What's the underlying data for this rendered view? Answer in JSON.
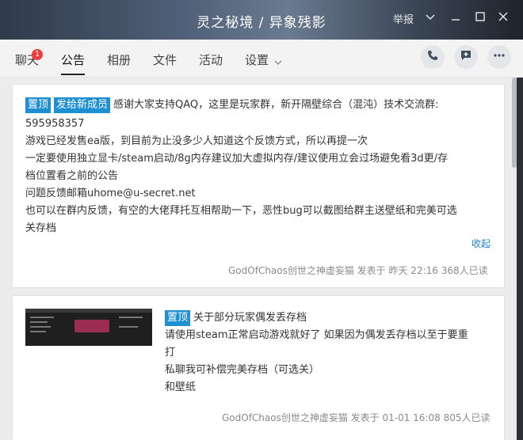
{
  "window": {
    "title": "灵之秘境 / 异象残影",
    "report_label": "举报"
  },
  "tabs": {
    "chat": "聊天",
    "chat_badge": "1",
    "notice": "公告",
    "album": "相册",
    "file": "文件",
    "activity": "活动",
    "settings": "设置"
  },
  "notices": [
    {
      "tags": [
        "置顶",
        "发给新成员"
      ],
      "lines": [
        "感谢大家支持QAQ，这里是玩家群，新开隔壁综合（混沌）技术交流群:",
        "595958357",
        "游戏已经发售ea版，到目前为止没多少人知道这个反馈方式，所以再提一次",
        "一定要使用独立显卡/steam启动/8g内存建议加大虚拟内存/建议使用立会过场避免看3d更/存",
        "档位置看之前的公告",
        "问题反馈邮箱uhome@u-secret.net",
        "也可以在群内反馈，有空的大佬拜托互相帮助一下，恶性bug可以截图给群主送壁纸和完美可选",
        "关存档"
      ],
      "collapse_label": "收起",
      "meta": "GodOfChaos创世之神虚妄猫 发表于 昨天 22:16   368人已读"
    },
    {
      "tags": [
        "置顶"
      ],
      "lines": [
        "关于部分玩家偶发丢存档",
        "请使用steam正常启动游戏就好了 如果因为偶发丢存档以至于要重",
        "打",
        "私聊我可补偿完美存档（可选关）",
        "和壁纸"
      ],
      "meta": "GodOfChaos创世之神虚妄猫 发表于 01-01 16:08   805人已读"
    }
  ],
  "colors": {
    "tag_bg": "#1e8fd0",
    "badge": "#f23c3c",
    "link": "#1e7fc8"
  }
}
